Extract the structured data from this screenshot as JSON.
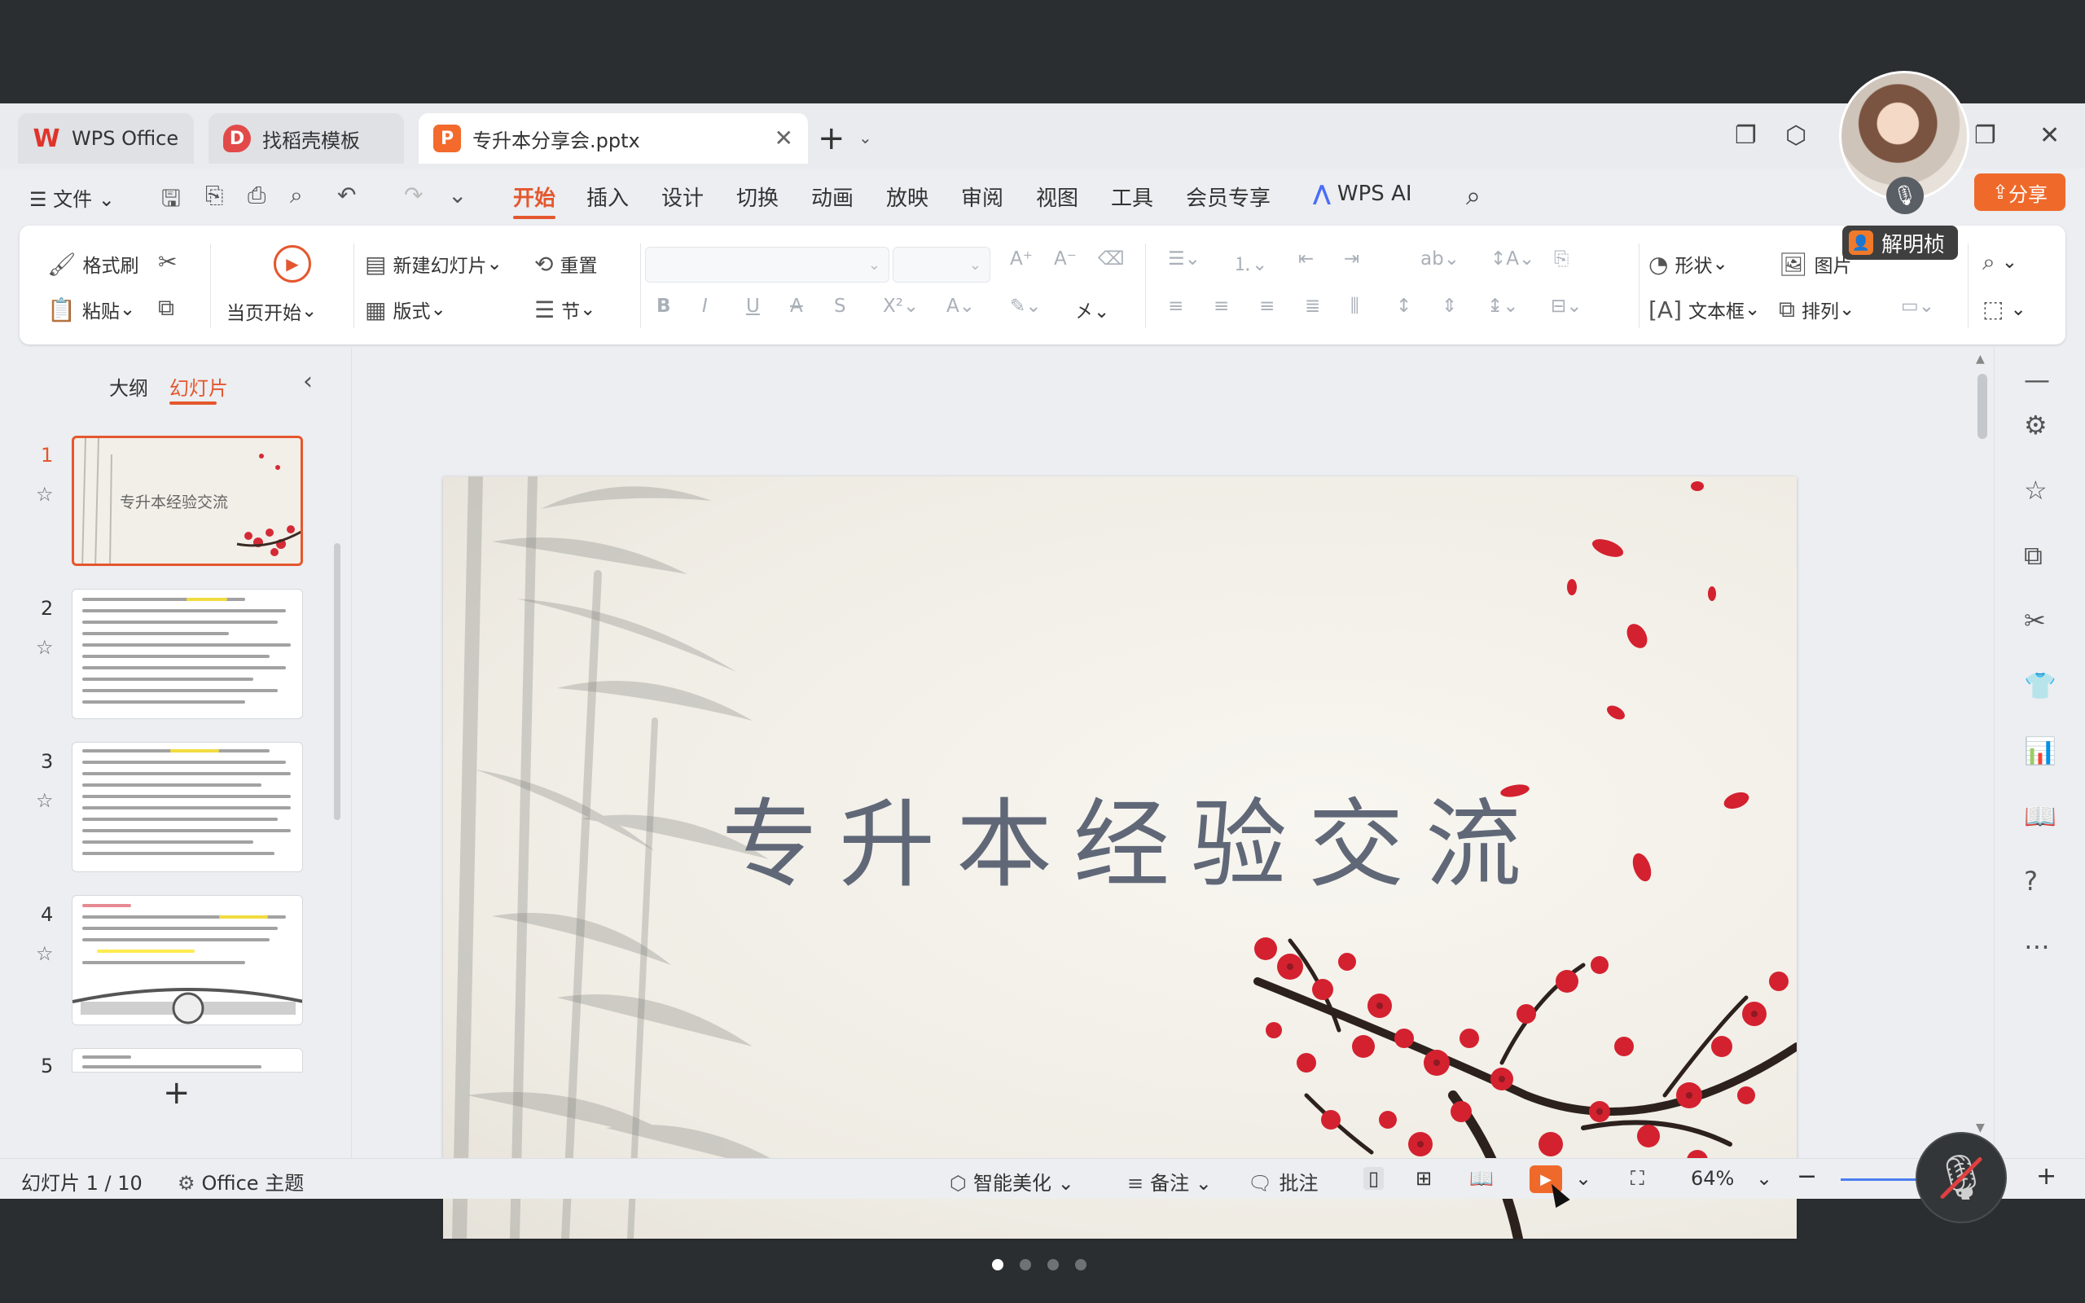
{
  "tabs": {
    "wps": "WPS Office",
    "templates": "找稻壳模板",
    "document": "专升本分享会.pptx"
  },
  "user": {
    "name": "解明桢"
  },
  "share_label": "分享",
  "menu": {
    "file": "文件",
    "tabs": [
      "开始",
      "插入",
      "设计",
      "切换",
      "动画",
      "放映",
      "审阅",
      "视图",
      "工具",
      "会员专享"
    ],
    "active_tab": "开始",
    "ai": "WPS AI"
  },
  "ribbon": {
    "format_painter": "格式刷",
    "paste": "粘贴",
    "from_current": "当页开始",
    "new_slide": "新建幻灯片",
    "layout": "版式",
    "reset": "重置",
    "section": "节",
    "shape": "形状",
    "picture": "图片",
    "textbox": "文本框",
    "arrange": "排列"
  },
  "left_panel": {
    "outline_tab": "大纲",
    "slides_tab": "幻灯片",
    "thumbnails": [
      {
        "number": "1",
        "title": "专升本经验交流"
      },
      {
        "number": "2"
      },
      {
        "number": "3"
      },
      {
        "number": "4"
      },
      {
        "number": "5"
      }
    ]
  },
  "slide": {
    "title": "专升本经验交流"
  },
  "status": {
    "slide_counter": "幻灯片 1 / 10",
    "theme": "Office 主题",
    "beautify": "智能美化",
    "notes": "备注",
    "comments": "批注",
    "zoom": "64%",
    "zoom_fraction": 0.64
  },
  "carousel": {
    "count": 4,
    "active_index": 0
  },
  "colors": {
    "accent": "#e4572e",
    "share": "#ef6a2a",
    "title_text": "#606878",
    "blossom": "#d4212f"
  }
}
